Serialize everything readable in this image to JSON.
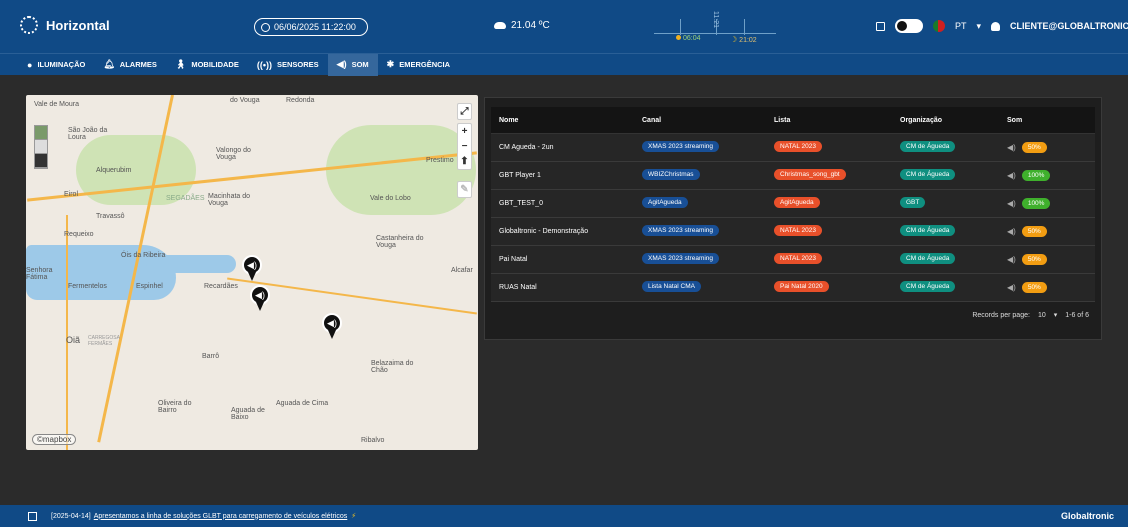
{
  "header": {
    "title": "Horizontal",
    "datetime": "06/06/2025 11:22:00",
    "temperature": "21.04 ºC",
    "sun": {
      "sunrise": "06:04",
      "sunset": "21:02",
      "now": "11:21"
    },
    "language": "PT",
    "user": "CLIENTE@GLOBALTRONIC.PT"
  },
  "nav": {
    "items": [
      {
        "label": "ILUMINAÇÃO",
        "icon": "light-bulb-icon"
      },
      {
        "label": "ALARMES",
        "icon": "bell-icon"
      },
      {
        "label": "MOBILIDADE",
        "icon": "walking-person-icon"
      },
      {
        "label": "SENSORES",
        "icon": "sensor-waves-icon"
      },
      {
        "label": "SOM",
        "icon": "speaker-icon",
        "active": true
      },
      {
        "label": "EMERGÊNCIA",
        "icon": "asterisk-icon"
      }
    ]
  },
  "map": {
    "labels": [
      "Vale de Moura",
      "do Vouga",
      "Redonda",
      "São João da Loura",
      "Valongo do Vouga",
      "Prestimo",
      "Alquerubim",
      "Eirol",
      "SEGADÃES",
      "Macinhata do Vouga",
      "Vale do Lobo",
      "Travassô",
      "Requeixo",
      "Óis da Ribeira",
      "Castanheira do Vouga",
      "Senhora Fátima",
      "Fermentelos",
      "Espinhel",
      "Recardães",
      "Alcafar",
      "Oiã",
      "CARREGOSA FERMÃES",
      "Barrô",
      "Belazaima do Chão",
      "Aguada de Cima",
      "Oliveira do Bairro",
      "Aguada de Baixo",
      "Ribalvo"
    ],
    "attribution": "©mapbox"
  },
  "table": {
    "headers": [
      "Nome",
      "Canal",
      "Lista",
      "Organização",
      "Som"
    ],
    "rows": [
      {
        "nome": "CM Agueda - 2un",
        "canal": "XMAS 2023 streaming",
        "lista": "NATAL 2023",
        "org": "CM de Águeda",
        "som": "50%"
      },
      {
        "nome": "GBT Player 1",
        "canal": "WBIZChristmas",
        "lista": "Christmas_song_gbt",
        "org": "CM de Águeda",
        "som": "100%"
      },
      {
        "nome": "GBT_TEST_0",
        "canal": "AgitAgueda",
        "lista": "AgitAgueda",
        "org": "GBT",
        "som": "100%"
      },
      {
        "nome": "Globaltronic - Demonstração",
        "canal": "XMAS 2023 streaming",
        "lista": "NATAL 2023",
        "org": "CM de Águeda",
        "som": "50%"
      },
      {
        "nome": "Pai Natal",
        "canal": "XMAS 2023 streaming",
        "lista": "NATAL 2023",
        "org": "CM de Águeda",
        "som": "50%"
      },
      {
        "nome": "RUAS Natal",
        "canal": "Lista Natal CMA",
        "lista": "Pai Natal 2020",
        "org": "CM de Águeda",
        "som": "50%"
      }
    ],
    "pager": {
      "label": "Records per page:",
      "per_page": "10",
      "range": "1-6 of 6"
    }
  },
  "footer": {
    "date": "[2025-04-14]",
    "news": "Apresentamos a linha de soluções GLBT para carregamento de veículos elétricos",
    "logo": "Globaltronic"
  },
  "colors": {
    "header": "#104a86",
    "chip_blue": "#184f96",
    "chip_red": "#e8502a",
    "chip_teal": "#0f8f80",
    "pct_orange": "#f29d12",
    "pct_green": "#3fb02c"
  }
}
